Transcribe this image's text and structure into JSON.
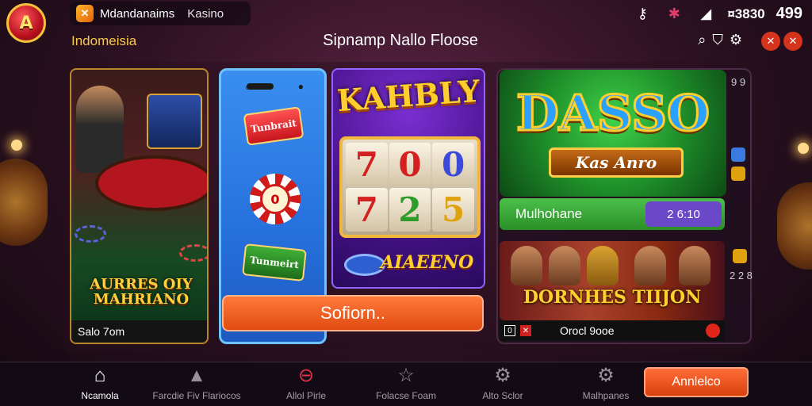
{
  "app": {
    "logo_text": "A",
    "icon_glyph": "✕",
    "name": "Mdandanaims",
    "sub_name": "Kasino",
    "region": "Indomeisia",
    "page_title": "Sipnamp Nallo Floose"
  },
  "status": {
    "coins": "¤3830",
    "balance": "499"
  },
  "cards": {
    "card1": {
      "title": "AURRES OIY MAHRIANO",
      "footer": "Salo 7om"
    },
    "card2": {
      "tag_top": "Tunbrait",
      "chip_value": "0",
      "tag_bottom": "Tunmeirt"
    },
    "slot": {
      "title": "KAHBLY",
      "reels": [
        "7",
        "0",
        "0",
        "7",
        "2",
        "5"
      ],
      "sub_title": "AIAEENO"
    },
    "cta": "Sofiorn..",
    "dasso": {
      "title": "DASSO",
      "banner": "Kas Anro"
    },
    "green_bar": {
      "label": "Mulhohane",
      "value": "2 6:10"
    },
    "chars": {
      "title": "DORNHES TIIJON",
      "footer_text": "Orocl 9ooe",
      "box1": "0",
      "box2": "✕"
    },
    "side_top": "9 9",
    "side_bottom": "2 2 8"
  },
  "nav": [
    {
      "label": "Ncamola",
      "icon": "home-icon",
      "glyph": "⌂",
      "active": true
    },
    {
      "label": "Farcdie Fiv Flariocos",
      "icon": "building-icon",
      "glyph": "▲",
      "active": false
    },
    {
      "label": "Allol Pirle",
      "icon": "chip-icon",
      "glyph": "⊖",
      "active": false
    },
    {
      "label": "Folacse Foam",
      "icon": "star-icon",
      "glyph": "☆",
      "active": false
    },
    {
      "label": "Alto Sclor",
      "icon": "gear-icon",
      "glyph": "⚙",
      "active": false
    },
    {
      "label": "Malhpanes",
      "icon": "settings-alert-icon",
      "glyph": "⚙",
      "active": false
    }
  ],
  "nav_button": "Annlelco",
  "colors": {
    "accent_gold": "#f6c94a",
    "cta_orange": "#e04b12",
    "green": "#2b8f28",
    "blue_card": "#2670dc",
    "purple": "#4b1490"
  }
}
